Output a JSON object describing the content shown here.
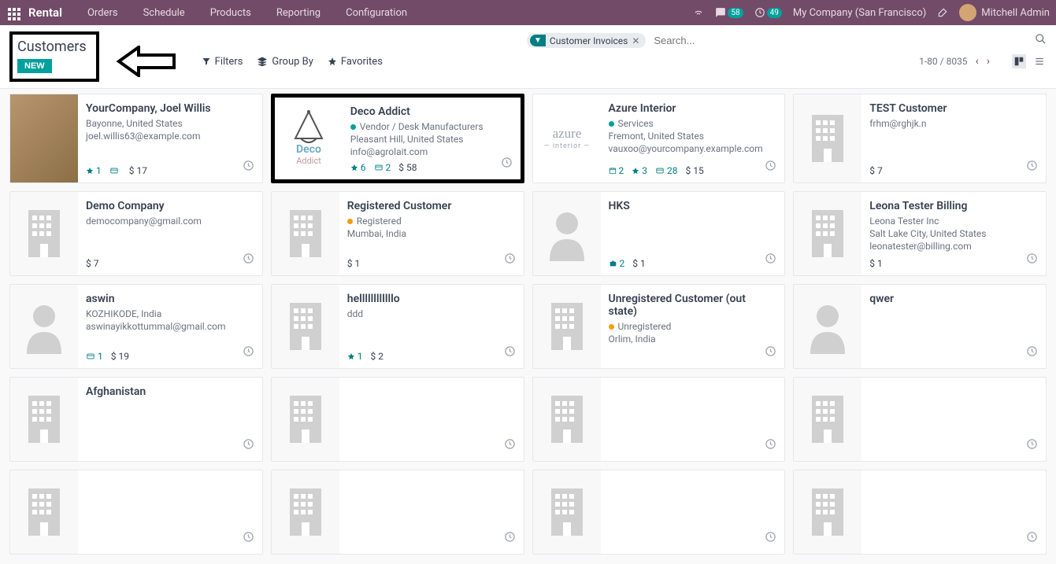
{
  "topbar": {
    "brand": "Rental",
    "menu": [
      "Orders",
      "Schedule",
      "Products",
      "Reporting",
      "Configuration"
    ],
    "chat_count": "58",
    "activity_count": "49",
    "company": "My Company (San Francisco)",
    "user": "Mitchell Admin"
  },
  "header": {
    "title": "Customers",
    "new_label": "NEW"
  },
  "search": {
    "facet_label": "Customer Invoices",
    "placeholder": "Search..."
  },
  "toolbar": {
    "filters": "Filters",
    "groupby": "Group By",
    "favorites": "Favorites",
    "pager_range": "1-80",
    "pager_total": "8035"
  },
  "cards": [
    {
      "title": "YourCompany, Joel Willis",
      "line1": "Bayonne, United States",
      "line2": "joel.willis63@example.com",
      "stats": [
        {
          "icon": "star",
          "v": "1"
        },
        {
          "icon": "card",
          "v": ""
        },
        {
          "icon": "money",
          "v": "$ 17"
        }
      ],
      "img": "photo"
    },
    {
      "title": "Deco Addict",
      "tags": [
        {
          "color": "teal",
          "text": "Vendor / Desk Manufacturers"
        }
      ],
      "line1": "Pleasant Hill, United States",
      "line2": "info@agrolait.com",
      "stats": [
        {
          "icon": "star",
          "v": "6"
        },
        {
          "icon": "card",
          "v": "2"
        },
        {
          "icon": "money",
          "v": "$ 58"
        }
      ],
      "img": "deco",
      "highlight": true
    },
    {
      "title": "Azure Interior",
      "tags": [
        {
          "color": "teal",
          "text": "Services"
        }
      ],
      "line1": "Fremont, United States",
      "line2": "vauxoo@yourcompany.example.com",
      "stats": [
        {
          "icon": "cal",
          "v": "2"
        },
        {
          "icon": "star",
          "v": "3"
        },
        {
          "icon": "card",
          "v": "28"
        },
        {
          "icon": "money",
          "v": "$ 15"
        }
      ],
      "img": "azure"
    },
    {
      "title": "TEST Customer",
      "line1": "frhm@rghjk.n",
      "stats": [
        {
          "icon": "money",
          "v": "$ 7"
        }
      ],
      "img": "building"
    },
    {
      "title": "Demo Company",
      "line1": "democompany@gmail.com",
      "stats": [
        {
          "icon": "money",
          "v": "$ 7"
        }
      ],
      "img": "building"
    },
    {
      "title": "Registered Customer",
      "tags": [
        {
          "color": "orange",
          "text": "Registered"
        }
      ],
      "line1": "Mumbai, India",
      "stats": [
        {
          "icon": "money",
          "v": "$ 1"
        }
      ],
      "img": "building"
    },
    {
      "title": "HKS",
      "stats": [
        {
          "icon": "brief",
          "v": "2"
        },
        {
          "icon": "money",
          "v": "$ 1"
        }
      ],
      "img": "person"
    },
    {
      "title": "Leona Tester Billing",
      "line1": "Leona Tester Inc",
      "line2": "Salt Lake City, United States",
      "line3": "leonatester@billing.com",
      "stats": [
        {
          "icon": "money",
          "v": "$ 1"
        }
      ],
      "img": "building"
    },
    {
      "title": "aswin",
      "line1": "KOZHIKODE, India",
      "line2": "aswinayikkottummal@gmail.com",
      "stats": [
        {
          "icon": "card",
          "v": "1"
        },
        {
          "icon": "money",
          "v": "$ 19"
        }
      ],
      "img": "person"
    },
    {
      "title": "hellllllllllllo",
      "line1": "ddd",
      "stats": [
        {
          "icon": "star",
          "v": "1"
        },
        {
          "icon": "money",
          "v": "$ 2"
        }
      ],
      "img": "building"
    },
    {
      "title": "Unregistered Customer (out state)",
      "tags": [
        {
          "color": "orange",
          "text": "Unregistered"
        }
      ],
      "line1": "Orlim, India",
      "img": "building"
    },
    {
      "title": "qwer",
      "img": "person"
    },
    {
      "title": "Afghanistan",
      "img": "building"
    },
    {
      "title": "",
      "img": "building"
    },
    {
      "title": "",
      "img": "building"
    },
    {
      "title": "",
      "img": "building"
    },
    {
      "title": "",
      "img": "building"
    },
    {
      "title": "",
      "img": "building"
    },
    {
      "title": "",
      "img": "building"
    },
    {
      "title": "",
      "img": "building"
    }
  ]
}
